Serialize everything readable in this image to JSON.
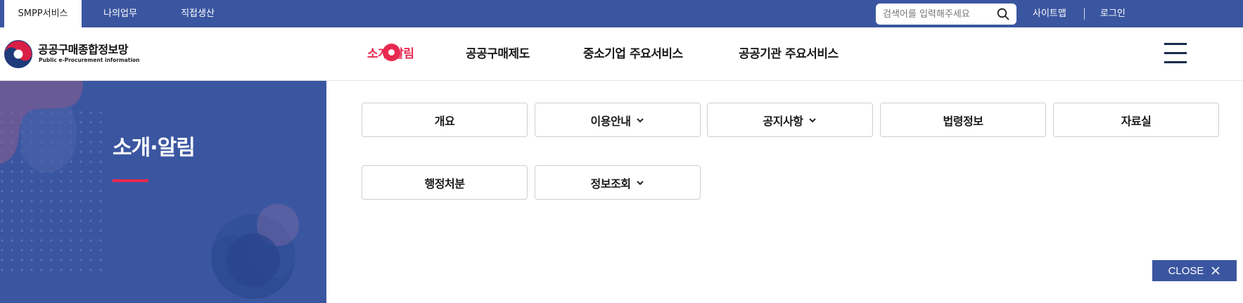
{
  "utility": {
    "tabs": [
      "SMPP서비스",
      "나의업무",
      "직접생산"
    ],
    "search_placeholder": "검색어를 입력해주세요",
    "links": [
      "사이트맵",
      "로그인"
    ]
  },
  "header": {
    "logo_ko": "공공구매종합정보망",
    "logo_en": "Public e-Procurement information",
    "nav": [
      "소개·알림",
      "공공구매제도",
      "중소기업 주요서비스",
      "공공기관 주요서비스"
    ],
    "active_nav": 0
  },
  "side": {
    "title": "소개·알림"
  },
  "submenu": {
    "items": [
      {
        "label": "개요",
        "has_dropdown": false
      },
      {
        "label": "이용안내",
        "has_dropdown": true
      },
      {
        "label": "공지사항",
        "has_dropdown": true
      },
      {
        "label": "법령정보",
        "has_dropdown": false
      },
      {
        "label": "자료실",
        "has_dropdown": false
      },
      {
        "label": "행정처분",
        "has_dropdown": false
      },
      {
        "label": "정보조회",
        "has_dropdown": true
      }
    ]
  },
  "close": {
    "label": "CLOSE"
  },
  "colors": {
    "brand_blue": "#3b56a0",
    "accent_red": "#e8294f"
  },
  "icons": [
    "search-icon",
    "hamburger-icon",
    "chevron-down-icon",
    "close-icon",
    "taegeuk-emblem-icon"
  ]
}
